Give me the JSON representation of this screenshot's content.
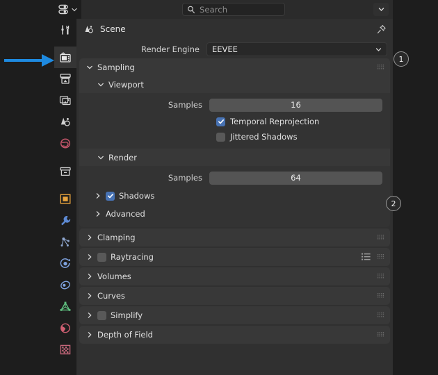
{
  "editor": {
    "type_button_name": "properties-editor-type",
    "icon": "properties-sliders-icon"
  },
  "header": {
    "search_placeholder": "Search",
    "search_value": "",
    "search_icon": "search-icon",
    "overflow_icon": "chevron-down-icon"
  },
  "tabs": [
    {
      "id": "tool",
      "label": "Tool",
      "icon": "tool-wrench-screwdriver-icon",
      "active": false,
      "color": "#d0d0d0"
    },
    {
      "id": "render",
      "label": "Render",
      "icon": "render-camera-back-icon",
      "active": true,
      "color": "#e8e8e8"
    },
    {
      "id": "output",
      "label": "Output",
      "icon": "output-printer-icon",
      "active": false,
      "color": "#d0d0d0"
    },
    {
      "id": "viewlayer",
      "label": "View Layer",
      "icon": "view-layer-images-icon",
      "active": false,
      "color": "#d0d0d0"
    },
    {
      "id": "scene",
      "label": "Scene",
      "icon": "scene-cone-sphere-icon",
      "active": false,
      "color": "#d0d0d0"
    },
    {
      "id": "world",
      "label": "World",
      "icon": "world-globe-icon",
      "active": false,
      "color": "#c4566a"
    },
    {
      "id": "collection",
      "label": "Collection",
      "icon": "collection-box-icon",
      "active": false,
      "color": "#d0d0d0"
    },
    {
      "id": "object",
      "label": "Object",
      "icon": "object-square-icon",
      "active": false,
      "color": "#e8a33d"
    },
    {
      "id": "modifiers",
      "label": "Modifiers",
      "icon": "modifier-wrench-icon",
      "active": false,
      "color": "#5d8ad4"
    },
    {
      "id": "particles",
      "label": "Particles",
      "icon": "particles-icon",
      "active": false,
      "color": "#8fa7cf"
    },
    {
      "id": "physics",
      "label": "Physics",
      "icon": "physics-orbit-icon",
      "active": false,
      "color": "#7fa3e0"
    },
    {
      "id": "constraints",
      "label": "Object Constraints",
      "icon": "constraints-clamp-icon",
      "active": false,
      "color": "#7fa3e0"
    },
    {
      "id": "data",
      "label": "Object Data",
      "icon": "object-data-triangle-icon",
      "active": false,
      "color": "#5fbf7f"
    },
    {
      "id": "material",
      "label": "Material",
      "icon": "material-sphere-icon",
      "active": false,
      "color": "#cf5f72"
    },
    {
      "id": "texture",
      "label": "Texture",
      "icon": "texture-checker-icon",
      "active": false,
      "color": "#c4677a"
    }
  ],
  "breadcrumb": {
    "icon": "scene-cone-sphere-icon",
    "label": "Scene",
    "pin_icon": "pin-icon"
  },
  "render_engine": {
    "label": "Render Engine",
    "value": "EEVEE",
    "chevron_icon": "chevron-down-icon"
  },
  "sections": {
    "sampling": {
      "title": "Sampling",
      "expanded": true,
      "grip_icon": "grip-dots-icon",
      "viewport": {
        "title": "Viewport",
        "expanded": true,
        "samples_label": "Samples",
        "samples_value": "16",
        "temporal_reprojection_label": "Temporal Reprojection",
        "temporal_reprojection_checked": true,
        "jittered_shadows_label": "Jittered Shadows",
        "jittered_shadows_checked": false
      },
      "render": {
        "title": "Render",
        "expanded": true,
        "samples_label": "Samples",
        "samples_value": "64",
        "shadows_label": "Shadows",
        "shadows_checked": true,
        "advanced_label": "Advanced"
      }
    },
    "collapsed": [
      {
        "title": "Clamping",
        "has_checkbox": false,
        "checked": false,
        "has_preset_list": false,
        "grip_icon": "grip-dots-icon"
      },
      {
        "title": "Raytracing",
        "has_checkbox": true,
        "checked": false,
        "has_preset_list": true,
        "grip_icon": "grip-dots-icon"
      },
      {
        "title": "Volumes",
        "has_checkbox": false,
        "checked": false,
        "has_preset_list": false,
        "grip_icon": "grip-dots-icon"
      },
      {
        "title": "Curves",
        "has_checkbox": false,
        "checked": false,
        "has_preset_list": false,
        "grip_icon": "grip-dots-icon"
      },
      {
        "title": "Simplify",
        "has_checkbox": true,
        "checked": false,
        "has_preset_list": false,
        "grip_icon": "grip-dots-icon"
      },
      {
        "title": "Depth of Field",
        "has_checkbox": false,
        "checked": false,
        "has_preset_list": false,
        "grip_icon": "grip-dots-icon"
      }
    ]
  },
  "annotations": {
    "arrow": {
      "target": "render-properties-tab",
      "color": "#1e8ae0"
    },
    "badges": [
      {
        "id": "1",
        "label": "1",
        "target": "render-engine-dropdown"
      },
      {
        "id": "2",
        "label": "2",
        "target": "render-samples-field"
      }
    ]
  },
  "colors": {
    "app_bg": "#1d1d1d",
    "panel_bg": "#303030",
    "section_header": "#383838",
    "section_body": "#333333",
    "field_bg": "#545454",
    "accent_blue": "#4772b3",
    "annotation_blue": "#1e8ae0",
    "text": "#e0e0e0"
  }
}
